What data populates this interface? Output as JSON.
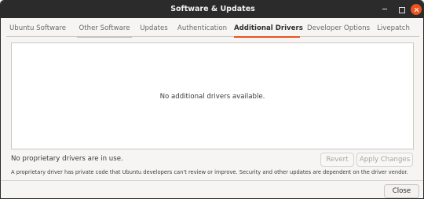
{
  "window": {
    "title": "Software & Updates"
  },
  "tabs": [
    {
      "label": "Ubuntu Software"
    },
    {
      "label": "Other Software"
    },
    {
      "label": "Updates"
    },
    {
      "label": "Authentication"
    },
    {
      "label": "Additional Drivers",
      "active": true
    },
    {
      "label": "Developer Options"
    },
    {
      "label": "Livepatch"
    }
  ],
  "drivers": {
    "empty_message": "No additional drivers available."
  },
  "status": {
    "text": "No proprietary drivers are in use."
  },
  "buttons": {
    "revert": "Revert",
    "apply": "Apply Changes",
    "close": "Close"
  },
  "note": "A proprietary driver has private code that Ubuntu developers can't review or improve. Security and other updates are dependent on the driver vendor.",
  "colors": {
    "accent": "#e95420",
    "titlebar": "#2b2b2b"
  }
}
